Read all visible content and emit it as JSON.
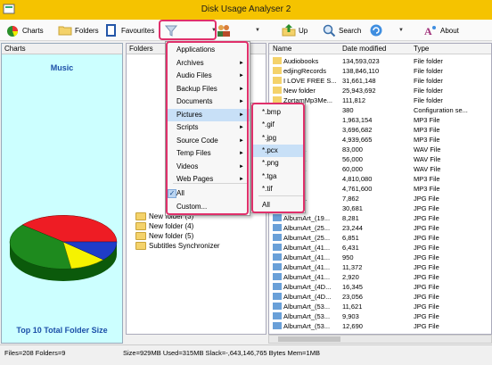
{
  "window": {
    "title": "Disk Usage Analyser 2"
  },
  "toolbar": {
    "charts": "Charts",
    "folders": "Folders",
    "favourites": "Favourites",
    "up": "Up",
    "search": "Search",
    "about": "About"
  },
  "panels": {
    "charts": "Charts",
    "folders": "Folders"
  },
  "chart": {
    "title": "Music",
    "footer": "Top 10 Total Folder Size",
    "colors": {
      "red": "#ee1c24",
      "green": "#1e8a1e",
      "yellow": "#f6f200",
      "blue": "#1f3cc8"
    }
  },
  "tree": {
    "items": [
      "New folder (3)",
      "New folder (4)",
      "New folder (5)",
      "Subtitles Synchronizer"
    ]
  },
  "files": {
    "columns": {
      "name": "Name",
      "date": "Date modified",
      "type": "Type"
    },
    "rows": [
      {
        "name": "Audiobooks",
        "date": "134,593,023",
        "type": "File folder"
      },
      {
        "name": "edjingRecords",
        "date": "138,846,110",
        "type": "File folder"
      },
      {
        "name": "I LOVE FREE S...",
        "date": "31,661,148",
        "type": "File folder"
      },
      {
        "name": "New folder",
        "date": "25,943,692",
        "type": "File folder"
      },
      {
        "name": "ZortamMp3Me...",
        "date": "111,812",
        "type": "File folder"
      },
      {
        "name": "",
        "date": "380",
        "type": "Configuration se..."
      },
      {
        "name": "",
        "date": "1,963,154",
        "type": "MP3 File"
      },
      {
        "name": "...row...",
        "date": "3,696,682",
        "type": "MP3 File"
      },
      {
        "name": "",
        "date": "4,939,665",
        "type": "MP3 File"
      },
      {
        "name": "...Rec...",
        "date": "83,000",
        "type": "WAV File"
      },
      {
        "name": "...Rec...",
        "date": "56,000",
        "type": "WAV File"
      },
      {
        "name": "...Rec...",
        "date": "60,000",
        "type": "WAV File"
      },
      {
        "name": "",
        "date": "4,810,080",
        "type": "MP3 File"
      },
      {
        "name": "",
        "date": "4,761,600",
        "type": "MP3 File"
      },
      {
        "name": "...mall...",
        "date": "7,862",
        "type": "JPG File"
      },
      {
        "name": "...(1)...",
        "date": "30,681",
        "type": "JPG File"
      },
      {
        "name": "AlbumArt_(19...",
        "date": "8,281",
        "type": "JPG File"
      },
      {
        "name": "AlbumArt_(25...",
        "date": "23,244",
        "type": "JPG File"
      },
      {
        "name": "AlbumArt_(25...",
        "date": "6,851",
        "type": "JPG File"
      },
      {
        "name": "AlbumArt_(41...",
        "date": "6,431",
        "type": "JPG File"
      },
      {
        "name": "AlbumArt_(41...",
        "date": "950",
        "type": "JPG File"
      },
      {
        "name": "AlbumArt_(41...",
        "date": "11,372",
        "type": "JPG File"
      },
      {
        "name": "AlbumArt_(41...",
        "date": "2,920",
        "type": "JPG File"
      },
      {
        "name": "AlbumArt_(4D...",
        "date": "16,345",
        "type": "JPG File"
      },
      {
        "name": "AlbumArt_(4D...",
        "date": "23,056",
        "type": "JPG File"
      },
      {
        "name": "AlbumArt_(53...",
        "date": "11,621",
        "type": "JPG File"
      },
      {
        "name": "AlbumArt_(53...",
        "date": "9,903",
        "type": "JPG File"
      },
      {
        "name": "AlbumArt_(53...",
        "date": "12,690",
        "type": "JPG File"
      }
    ]
  },
  "menu": {
    "items": [
      {
        "label": "Applications",
        "arrow": false
      },
      {
        "label": "Archives",
        "arrow": true
      },
      {
        "label": "Audio Files",
        "arrow": true
      },
      {
        "label": "Backup Files",
        "arrow": true
      },
      {
        "label": "Documents",
        "arrow": true
      },
      {
        "label": "Pictures",
        "arrow": true
      },
      {
        "label": "Scripts",
        "arrow": true
      },
      {
        "label": "Source Code",
        "arrow": true
      },
      {
        "label": "Temp Files",
        "arrow": true
      },
      {
        "label": "Videos",
        "arrow": true
      },
      {
        "label": "Web Pages",
        "arrow": true
      }
    ],
    "all": "All",
    "custom": "Custom..."
  },
  "submenu": {
    "items": [
      "*.bmp",
      "*.gif",
      "*.jpg",
      "*.pcx",
      "*.png",
      "*.tga",
      "*.tif"
    ],
    "all": "All"
  },
  "status": {
    "left": "Files=208 Folders=9",
    "right": "Size=929MB Used=315MB Slack=-,643,146,765 Bytes Mem=1MB"
  }
}
